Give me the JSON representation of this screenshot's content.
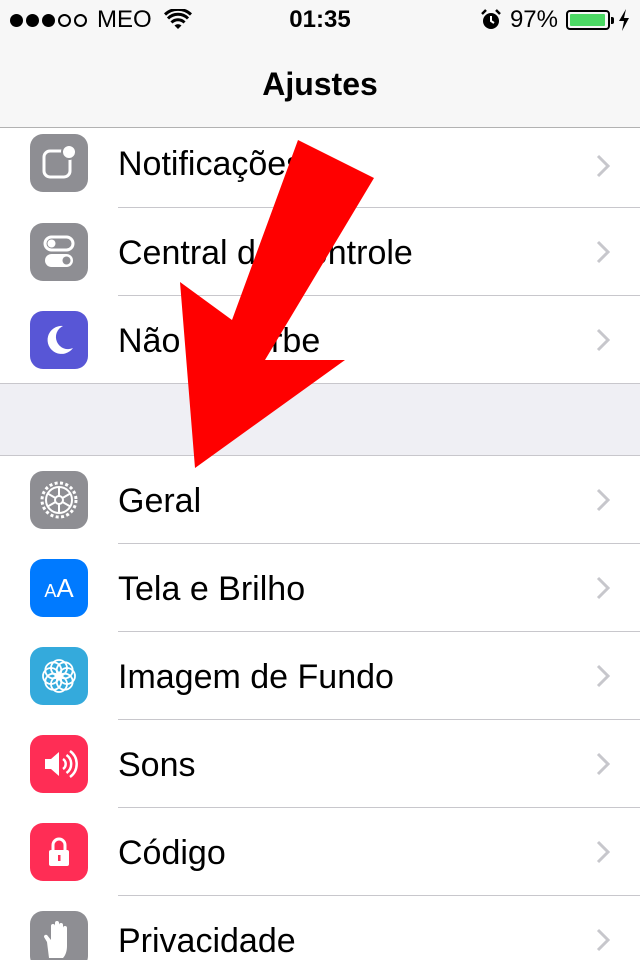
{
  "status_bar": {
    "carrier": "MEO",
    "time": "01:35",
    "battery_percent_text": "97%",
    "battery_level": 0.97,
    "signal_bars_filled": 3,
    "signal_bars_total": 5,
    "icons": [
      "wifi-icon",
      "alarm-icon",
      "battery-icon",
      "charging-bolt-icon"
    ]
  },
  "nav": {
    "title": "Ajustes"
  },
  "groups": [
    {
      "items": [
        {
          "label": "Notificações",
          "icon": "notifications-icon",
          "icon_color": "#8e8e93"
        },
        {
          "label": "Central de Controle",
          "icon": "control-center-icon",
          "icon_color": "#8e8e93"
        },
        {
          "label": "Não Perturbe",
          "icon": "moon-icon",
          "icon_color": "#5856d6"
        }
      ]
    },
    {
      "items": [
        {
          "label": "Geral",
          "icon": "gear-icon",
          "icon_color": "#8e8e93"
        },
        {
          "label": "Tela e Brilho",
          "icon": "text-size-icon",
          "icon_color": "#007aff"
        },
        {
          "label": "Imagem de Fundo",
          "icon": "wallpaper-flower-icon",
          "icon_color": "#34aadc"
        },
        {
          "label": "Sons",
          "icon": "speaker-icon",
          "icon_color": "#ff2d55"
        },
        {
          "label": "Código",
          "icon": "lock-icon",
          "icon_color": "#ff2d55"
        },
        {
          "label": "Privacidade",
          "icon": "hand-icon",
          "icon_color": "#8e8e93"
        }
      ]
    }
  ],
  "overlay": {
    "arrow_color": "#ff0000",
    "icon": "red-arrow-icon"
  },
  "ui": {
    "text_size_icon_glyph": "AA",
    "chevron_icon": "chevron-right-icon"
  }
}
